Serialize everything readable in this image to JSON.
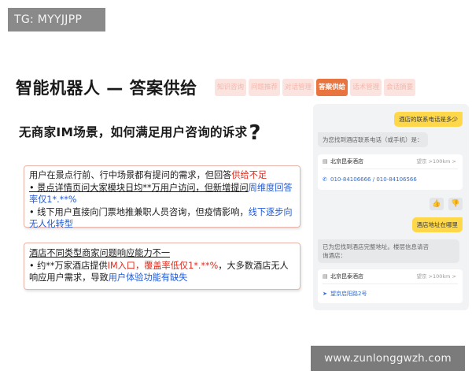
{
  "badge": "TG: MYYJJPP",
  "slide_title": "智能机器人 — 答案供给",
  "tabs": [
    "知识咨询",
    "问题推荐",
    "对话管理",
    "答案供给",
    "话术管理",
    "会话摘要"
  ],
  "question": {
    "text": "无商家IM场景，如何满足用户咨询的诉求",
    "qmark": "?"
  },
  "card1": {
    "line1_a": "用户在景点行前、行中场景都有提问的需求，但回答",
    "line1_b": "供给不足",
    "bullet1_a": "• 景点详情页问大家模块日均**万用户访问，但新增提问",
    "bullet1_b": "周维度回答率仅1*.**%",
    "bullet2_a": "• 线下用户直接向门票地推兼职人员咨询，但疫情影响，",
    "bullet2_b": "线下逐步向无人化转型"
  },
  "card2": {
    "heading": "酒店不同类型商家问题响应能力不一",
    "bullet_a": "• 约**万家酒店提供",
    "bullet_b": "IM入口，覆盖率低仅1*.**%",
    "bullet_c": "，大多数酒店无人响应用户需求，导致",
    "bullet_d": "用户体验功能有缺失"
  },
  "chat": {
    "q1": "酒店的联系电话是多少",
    "a1": "为您找到酒店联系电话（或手机）是：",
    "hotel_name": "北京昆泰酒店",
    "hotel_meta": "望京 >100km >",
    "phone_numbers": "010-84106666 / 010-84106566",
    "q2": "酒店地址在哪里",
    "a2_line1": "已为您找到酒店完整地址。楼层信息请咨",
    "a2_line2": "询酒店：",
    "hotel_name2": "北京昆泰酒店",
    "hotel_meta2": "望京 >100km >",
    "address": "望京启阳路2号",
    "thumb_up": "👍",
    "thumb_down": "👎"
  },
  "watermark": "www.zunlonggwzh.com"
}
